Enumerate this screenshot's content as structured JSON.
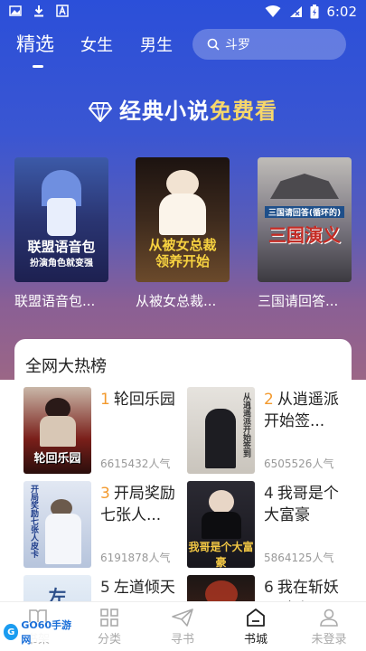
{
  "status_bar": {
    "time": "6:02"
  },
  "nav": {
    "tabs": [
      {
        "label": "精选",
        "active": true
      },
      {
        "label": "女生",
        "active": false
      },
      {
        "label": "男生",
        "active": false
      }
    ],
    "search_placeholder": "斗罗"
  },
  "banner": {
    "prefix": "经典小说",
    "highlight": "免费看"
  },
  "featured": [
    {
      "title": "联盟语音包...",
      "cover_text": "联盟语音包",
      "cover_sub": "扮演角色就变强",
      "cover_color": "#2b3d7a"
    },
    {
      "title": "从被女总裁...",
      "cover_text": "从被女总裁",
      "cover_sub": "领养开始",
      "cover_color": "#3a2418"
    },
    {
      "title": "三国请回答...",
      "cover_text": "三国演义",
      "cover_sub": "三国请回答(循环的)",
      "cover_color": "#6b6a6e"
    }
  ],
  "ranking": {
    "title": "全网大热榜",
    "items": [
      {
        "rank": "1",
        "name": "轮回乐园",
        "count": "6615432人气",
        "cover_text": "轮回乐园",
        "cover_color": "#7a1f1a"
      },
      {
        "rank": "2",
        "name": "从逍遥派开始签...",
        "count": "6505526人气",
        "cover_text": "从逍遥派开始签到",
        "cover_color": "#d9d6d1"
      },
      {
        "rank": "3",
        "name": "开局奖励七张人...",
        "count": "6191878人气",
        "cover_text": "开局奖励七张人皮卡",
        "cover_color": "#c8d3e6"
      },
      {
        "rank": "4",
        "name": "我哥是个大富豪",
        "count": "5864125人气",
        "cover_text": "我哥是个大富豪",
        "cover_color": "#1c1c24"
      },
      {
        "rank": "5",
        "name": "左道倾天",
        "count": "",
        "cover_text": "左",
        "cover_color": "#dbe6f2"
      },
      {
        "rank": "6",
        "name": "我在斩妖司除魔",
        "count": "",
        "cover_text": "",
        "cover_color": "#5a2a1e"
      }
    ]
  },
  "bottom_nav": [
    {
      "label": "书架",
      "icon": "bookshelf-icon",
      "active": false
    },
    {
      "label": "分类",
      "icon": "category-icon",
      "active": false
    },
    {
      "label": "寻书",
      "icon": "paper-plane-icon",
      "active": false
    },
    {
      "label": "书城",
      "icon": "bookstore-icon",
      "active": true
    },
    {
      "label": "未登录",
      "icon": "user-icon",
      "active": false
    }
  ],
  "watermark": {
    "badge": "G",
    "text": "GO60手游网"
  }
}
